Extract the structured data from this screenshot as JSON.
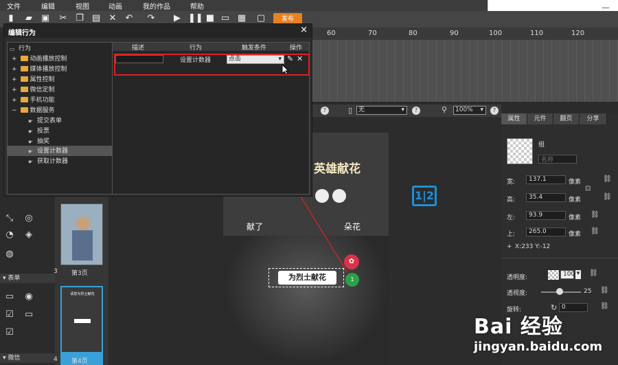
{
  "menu": [
    "文件",
    "编辑",
    "视图",
    "动画",
    "我的作品",
    "帮助"
  ],
  "toolbar": {
    "publish_label": "发布"
  },
  "ruler": [
    "60",
    "70",
    "80",
    "90",
    "100",
    "110",
    "120"
  ],
  "dialog": {
    "title": "编辑行为",
    "close": "×",
    "tree": {
      "root": "行为",
      "groups": [
        "动画播放控制",
        "媒体播放控制",
        "属性控制",
        "微信定制",
        "手机功能",
        "数据服务"
      ],
      "leaves": [
        "提交表单",
        "投票",
        "抽奖",
        "设置计数器",
        "获取计数器"
      ]
    },
    "columns": [
      "描述",
      "行为",
      "触发条件",
      "操作"
    ],
    "row": {
      "behavior": "设置计数器",
      "trigger": "点击"
    }
  },
  "canvas_bar": {
    "device": "无",
    "zoom": "100%"
  },
  "phone": {
    "title": "英雄献花",
    "left_text": "献了",
    "right_text": "朵花",
    "button": "为烈士献花",
    "counter_badge": "1",
    "counter_icon": "1|2"
  },
  "left_panel": {
    "section_form": "表单",
    "section_wechat": "微信"
  },
  "pages": [
    {
      "num": "3",
      "label": "第3页"
    },
    {
      "num": "4",
      "label": "第4页"
    }
  ],
  "thumb_text": "请您为烈士献花",
  "props": {
    "tabs": [
      "属性",
      "元件",
      "翻页",
      "分享"
    ],
    "group_label": "组",
    "name_placeholder": "名称",
    "width_label": "宽:",
    "width": "137.1",
    "height_label": "高:",
    "height": "35.4",
    "left_label": "左:",
    "left": "93.9",
    "top_label": "上:",
    "top": "265.0",
    "unit": "像素",
    "coords": "X:233   Y:-12",
    "opacity_label": "透明度:",
    "opacity": "100",
    "transparency_label": "透视度:",
    "transparency": "25",
    "rotate_label": "旋转:",
    "rotate": "0"
  },
  "watermark": {
    "brand": "Bai 经验",
    "url": "jingyan.baidu.com"
  }
}
